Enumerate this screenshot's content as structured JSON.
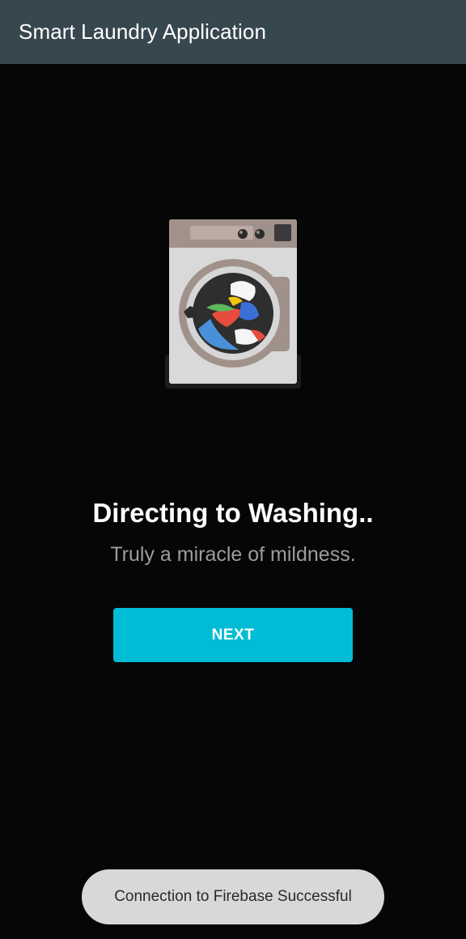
{
  "app_bar": {
    "title": "Smart Laundry Application"
  },
  "illustration": {
    "name": "washing-machine-illustration"
  },
  "content": {
    "heading": "Directing to Washing..",
    "subheading": "Truly a miracle of mildness."
  },
  "actions": {
    "next_label": "NEXT"
  },
  "toast": {
    "message": "Connection to Firebase Successful"
  },
  "colors": {
    "app_bar": "#37474f",
    "background": "#060606",
    "accent": "#00bcd4",
    "toast_bg": "#d8d8d8"
  }
}
